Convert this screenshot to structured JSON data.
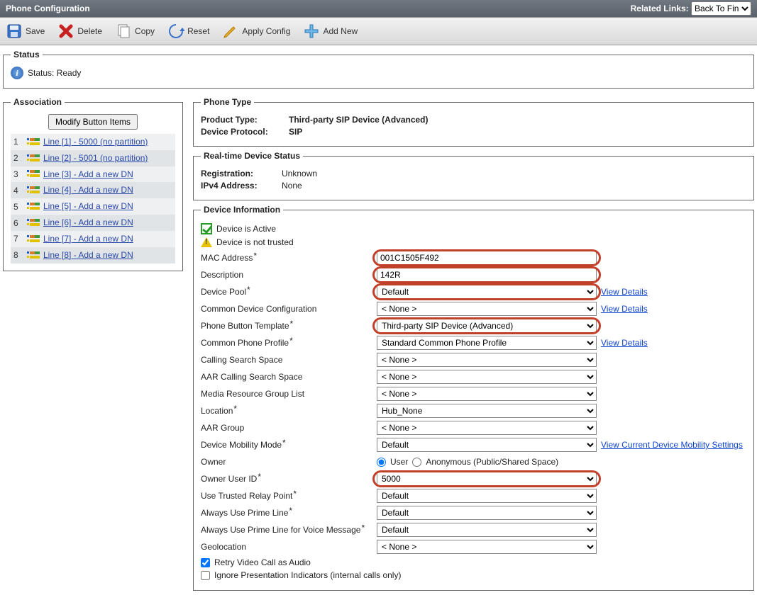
{
  "header": {
    "title": "Phone Configuration",
    "related_label": "Related Links:",
    "related_value": "Back To Fin"
  },
  "toolbar": {
    "save": "Save",
    "delete": "Delete",
    "copy": "Copy",
    "reset": "Reset",
    "apply": "Apply Config",
    "addnew": "Add New"
  },
  "status": {
    "legend": "Status",
    "text": "Status: Ready"
  },
  "association": {
    "legend": "Association",
    "modify_btn": "Modify Button Items",
    "lines": [
      {
        "n": "1",
        "label": "Line [1] - 5000 (no partition)"
      },
      {
        "n": "2",
        "label": "Line [2] - 5001 (no partition)"
      },
      {
        "n": "3",
        "label": "Line [3] - Add a new DN"
      },
      {
        "n": "4",
        "label": "Line [4] - Add a new DN"
      },
      {
        "n": "5",
        "label": "Line [5] - Add a new DN"
      },
      {
        "n": "6",
        "label": "Line [6] - Add a new DN"
      },
      {
        "n": "7",
        "label": "Line [7] - Add a new DN"
      },
      {
        "n": "8",
        "label": "Line [8] - Add a new DN"
      }
    ]
  },
  "phone_type": {
    "legend": "Phone Type",
    "product_label": "Product Type:",
    "product_value": "Third-party SIP Device (Advanced)",
    "protocol_label": "Device Protocol:",
    "protocol_value": "SIP"
  },
  "realtime": {
    "legend": "Real-time Device Status",
    "reg_label": "Registration:",
    "reg_value": "Unknown",
    "ipv4_label": "IPv4 Address:",
    "ipv4_value": "None"
  },
  "device_info": {
    "legend": "Device Information",
    "active": "Device is Active",
    "not_trusted": "Device is not trusted",
    "mac_label": "MAC Address",
    "mac_value": "001C1505F492",
    "desc_label": "Description",
    "desc_value": "142R",
    "pool_label": "Device Pool",
    "pool_value": "Default",
    "cdc_label": "Common Device Configuration",
    "cdc_value": "< None >",
    "pbt_label": "Phone Button Template",
    "pbt_value": "Third-party SIP Device (Advanced)",
    "cpp_label": "Common Phone Profile",
    "cpp_value": "Standard Common Phone Profile",
    "css_label": "Calling Search Space",
    "css_value": "< None >",
    "aarcss_label": "AAR Calling Search Space",
    "aarcss_value": "< None >",
    "mrgl_label": "Media Resource Group List",
    "mrgl_value": "< None >",
    "loc_label": "Location",
    "loc_value": "Hub_None",
    "aargrp_label": "AAR Group",
    "aargrp_value": "< None >",
    "dmm_label": "Device Mobility Mode",
    "dmm_value": "Default",
    "dmm_link": "View Current Device Mobility Settings",
    "owner_label": "Owner",
    "owner_user": "User",
    "owner_anon": "Anonymous (Public/Shared Space)",
    "ownerid_label": "Owner User ID",
    "ownerid_value": "5000",
    "utrp_label": "Use Trusted Relay Point",
    "utrp_value": "Default",
    "aupl_label": "Always Use Prime Line",
    "aupl_value": "Default",
    "auplvm_label": "Always Use Prime Line for Voice Message",
    "auplvm_value": "Default",
    "geo_label": "Geolocation",
    "geo_value": "< None >",
    "retry_video": "Retry Video Call as Audio",
    "ignore_pres": "Ignore Presentation Indicators (internal calls only)",
    "view_details": "View Details"
  }
}
